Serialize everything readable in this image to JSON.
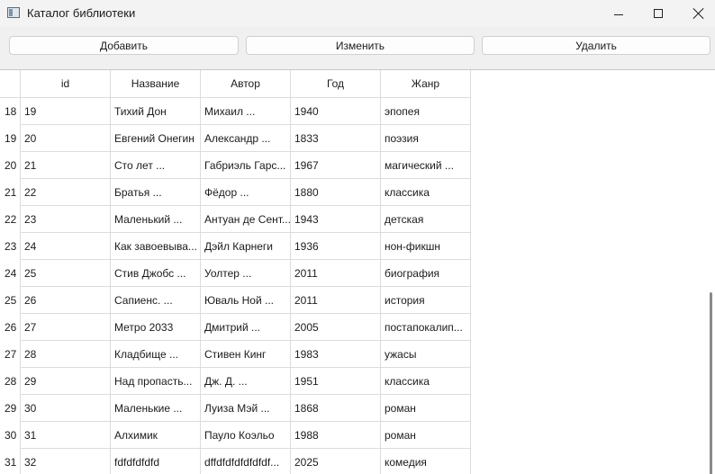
{
  "window": {
    "title": "Каталог библиотеки",
    "icon": "app-window-icon",
    "controls": [
      "minimize-icon",
      "maximize-icon",
      "close-icon"
    ]
  },
  "toolbar": {
    "add_label": "Добавить",
    "edit_label": "Изменить",
    "delete_label": "Удалить"
  },
  "table": {
    "columns": [
      "id",
      "Название",
      "Автор",
      "Год",
      "Жанр"
    ],
    "rows": [
      {
        "row_number": "18",
        "id": "19",
        "title": "Тихий Дон",
        "author": "Михаил ...",
        "year": "1940",
        "genre": "эпопея"
      },
      {
        "row_number": "19",
        "id": "20",
        "title": "Евгений Онегин",
        "author": "Александр ...",
        "year": "1833",
        "genre": "поэзия"
      },
      {
        "row_number": "20",
        "id": "21",
        "title": "Сто лет ...",
        "author": "Габриэль Гарс...",
        "year": "1967",
        "genre": "магический ..."
      },
      {
        "row_number": "21",
        "id": "22",
        "title": "Братья ...",
        "author": "Фёдор ...",
        "year": "1880",
        "genre": "классика"
      },
      {
        "row_number": "22",
        "id": "23",
        "title": "Маленький ...",
        "author": "Антуан де Сент...",
        "year": "1943",
        "genre": "детская"
      },
      {
        "row_number": "23",
        "id": "24",
        "title": "Как завоевыва...",
        "author": "Дэйл Карнеги",
        "year": "1936",
        "genre": "нон-фикшн"
      },
      {
        "row_number": "24",
        "id": "25",
        "title": "Стив Джобс ...",
        "author": "Уолтер ...",
        "year": "2011",
        "genre": "биография"
      },
      {
        "row_number": "25",
        "id": "26",
        "title": "Сапиенс. ...",
        "author": "Юваль Ной ...",
        "year": "2011",
        "genre": "история"
      },
      {
        "row_number": "26",
        "id": "27",
        "title": "Метро 2033",
        "author": "Дмитрий ...",
        "year": "2005",
        "genre": "постапокалип..."
      },
      {
        "row_number": "27",
        "id": "28",
        "title": "Кладбище ...",
        "author": "Стивен Кинг",
        "year": "1983",
        "genre": "ужасы"
      },
      {
        "row_number": "28",
        "id": "29",
        "title": "Над пропасть...",
        "author": "Дж. Д. ...",
        "year": "1951",
        "genre": "классика"
      },
      {
        "row_number": "29",
        "id": "30",
        "title": "Маленькие ...",
        "author": "Луиза Мэй ...",
        "year": "1868",
        "genre": "роман"
      },
      {
        "row_number": "30",
        "id": "31",
        "title": "Алхимик",
        "author": "Пауло Коэльо",
        "year": "1988",
        "genre": "роман"
      },
      {
        "row_number": "31",
        "id": "32",
        "title": "fdfdfdfdfd",
        "author": "dffdfdfdfdfdfdf...",
        "year": "2025",
        "genre": "комедия"
      }
    ]
  },
  "scrollbar": {
    "position_fraction": 0.55,
    "visible_fraction": 0.45
  }
}
